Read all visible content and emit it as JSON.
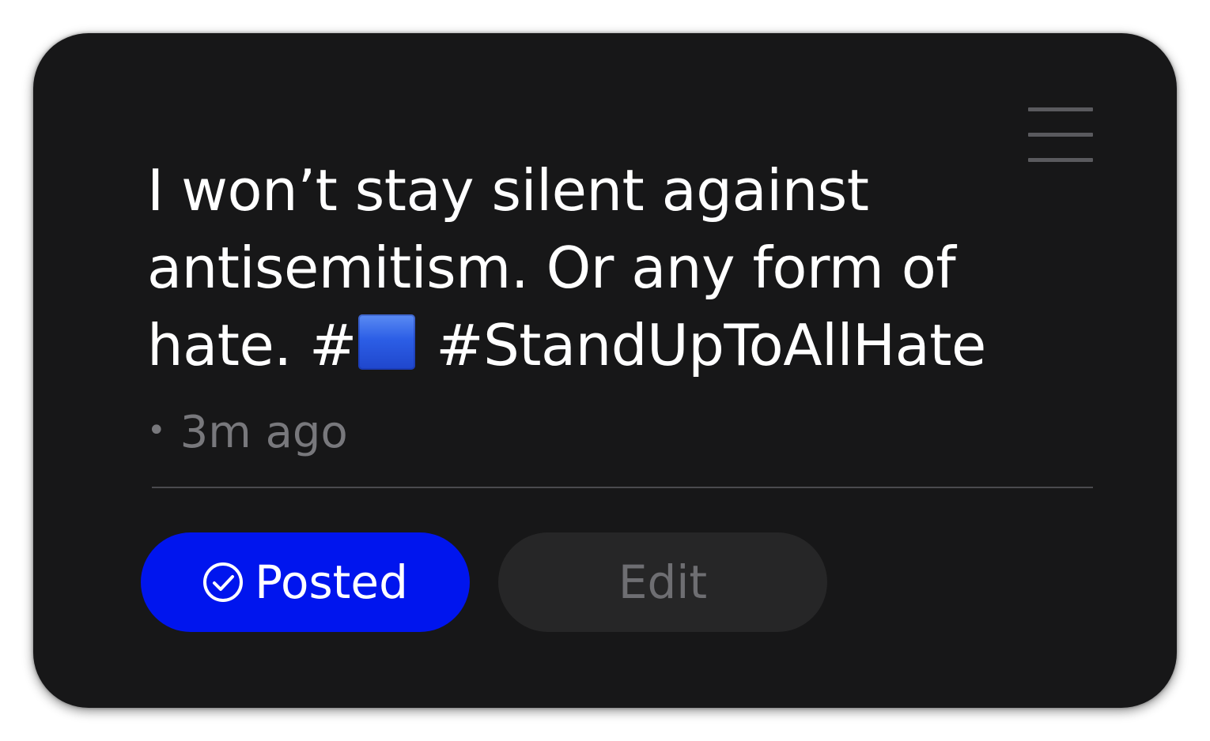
{
  "post": {
    "text_before_emoji": "I won’t stay silent against antisemitism. Or any form of hate. #",
    "emoji_icon": "blue-square-emoji",
    "text_after_emoji": " #StandUpToAllHate",
    "bullet": "•",
    "timestamp": "3m ago"
  },
  "actions": {
    "posted_label": "Posted",
    "posted_icon": "check-circle-icon",
    "edit_label": "Edit"
  },
  "colors": {
    "card_background": "#171718",
    "posted_button": "#0015ee",
    "edit_button": "#262627",
    "muted_text": "#78787c"
  }
}
